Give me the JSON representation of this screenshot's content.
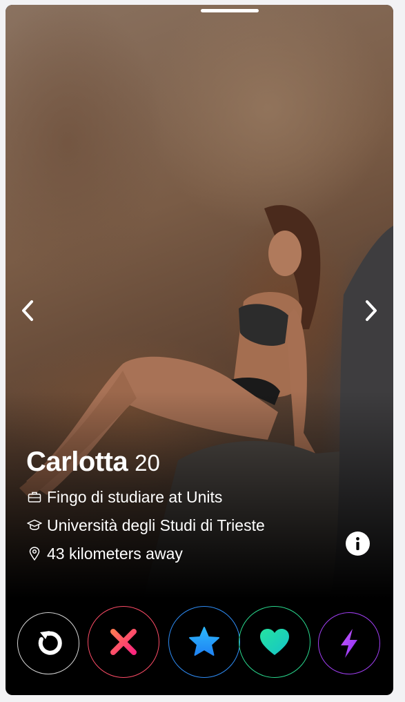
{
  "profile": {
    "name": "Carlotta",
    "age": "20",
    "job": "Fingo di studiare at Units",
    "school": "Università degli Studi di Trieste",
    "distance": "43 kilometers away"
  },
  "icons": {
    "prev": "chevron-left-icon",
    "next": "chevron-right-icon",
    "job": "briefcase-icon",
    "school": "graduation-cap-icon",
    "distance": "location-pin-icon",
    "info": "info-icon",
    "rewind": "rewind-icon",
    "nope": "x-icon",
    "super_like": "star-icon",
    "like": "heart-icon",
    "boost": "lightning-icon"
  },
  "colors": {
    "nope": "#fd4c67",
    "super_like": "#2e8df7",
    "like": "#29d98e",
    "boost": "#a23ff5",
    "rewind": "#d8d8d8"
  }
}
